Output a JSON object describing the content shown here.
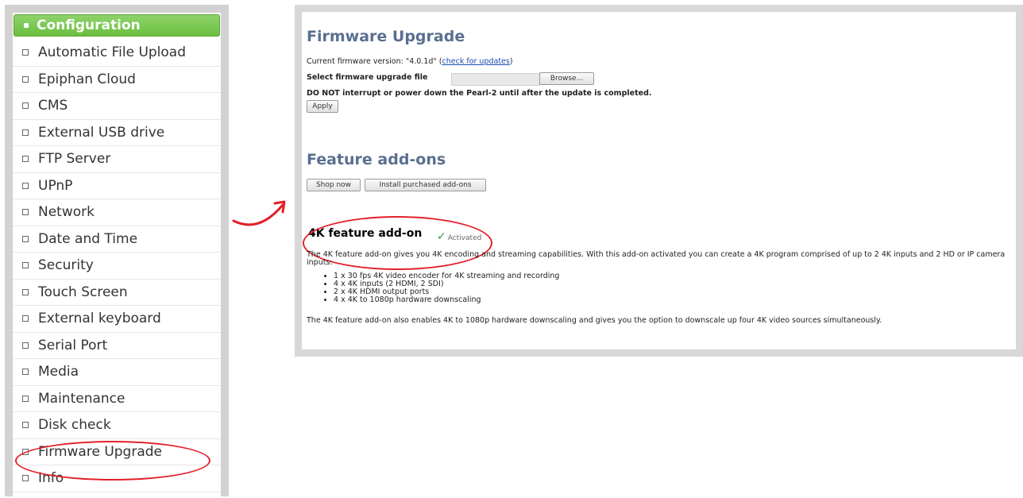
{
  "sidebar": {
    "header": "Configuration",
    "items": [
      {
        "label": "Automatic File Upload"
      },
      {
        "label": "Epiphan Cloud"
      },
      {
        "label": "CMS"
      },
      {
        "label": "External USB drive"
      },
      {
        "label": "FTP Server"
      },
      {
        "label": "UPnP"
      },
      {
        "label": "Network"
      },
      {
        "label": "Date and Time"
      },
      {
        "label": "Security"
      },
      {
        "label": "Touch Screen"
      },
      {
        "label": "External keyboard"
      },
      {
        "label": "Serial Port"
      },
      {
        "label": "Media"
      },
      {
        "label": "Maintenance"
      },
      {
        "label": "Disk check"
      },
      {
        "label": "Firmware Upgrade"
      },
      {
        "label": "Info"
      }
    ]
  },
  "firmware": {
    "title": "Firmware Upgrade",
    "version_prefix": "Current firmware version: \"4.0.1d\" (",
    "check_link": "check for updates",
    "version_suffix": ")",
    "select_label": "Select firmware upgrade file",
    "browse_label": "Browse...",
    "warning": "DO NOT interrupt or power down the Pearl-2 until after the update is completed.",
    "apply_label": "Apply"
  },
  "addons": {
    "title": "Feature add-ons",
    "shop_label": "Shop now",
    "install_label": "Install purchased add-ons",
    "feature_title": "4K feature add-on",
    "activated_label": "Activated",
    "description": "The 4K feature add-on gives you 4K encoding and streaming capabilities. With this add-on activated you can create a 4K program comprised of up to 2 4K inputs and 2 HD or IP camera inputs:",
    "features": [
      "1 x 30 fps 4K video encoder for 4K streaming and recording",
      "4 x 4K inputs (2 HDMI, 2 SDI)",
      "2 x 4K HDMI output ports",
      "4 x 4K to 1080p hardware downscaling"
    ],
    "footer": "The 4K feature add-on also enables 4K to 1080p hardware downscaling and gives you the option to downscale up four 4K video sources simultaneously."
  },
  "colors": {
    "accent_green": "#6abf3f",
    "highlight_red": "#e3202a",
    "heading_blue": "#5a6f8f"
  }
}
